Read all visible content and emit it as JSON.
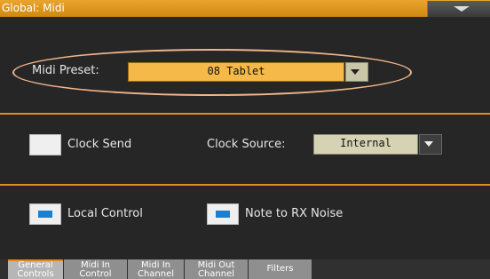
{
  "window": {
    "title": "Global: Midi"
  },
  "midi_preset": {
    "label": "Midi Preset:",
    "value": "08 Tablet"
  },
  "clock_send": {
    "label": "Clock Send"
  },
  "clock_source": {
    "label": "Clock Source:",
    "value": "Internal"
  },
  "local_control": {
    "label": "Local Control",
    "checked": true
  },
  "note_to_rx_noise": {
    "label": "Note to RX Noise",
    "checked": true
  },
  "tabs": [
    {
      "line1": "General",
      "line2": "Controls",
      "active": true
    },
    {
      "line1": "Midi In",
      "line2": "Control"
    },
    {
      "line1": "Midi In",
      "line2": "Channel"
    },
    {
      "line1": "Midi Out",
      "line2": "Channel"
    },
    {
      "line1": "Filters",
      "line2": ""
    }
  ],
  "colors": {
    "accent": "#e08b1f",
    "preset_field": "#f5b94a",
    "checkbox_mark": "#1a7fd0",
    "highlight_oval": "#f0b58a"
  }
}
